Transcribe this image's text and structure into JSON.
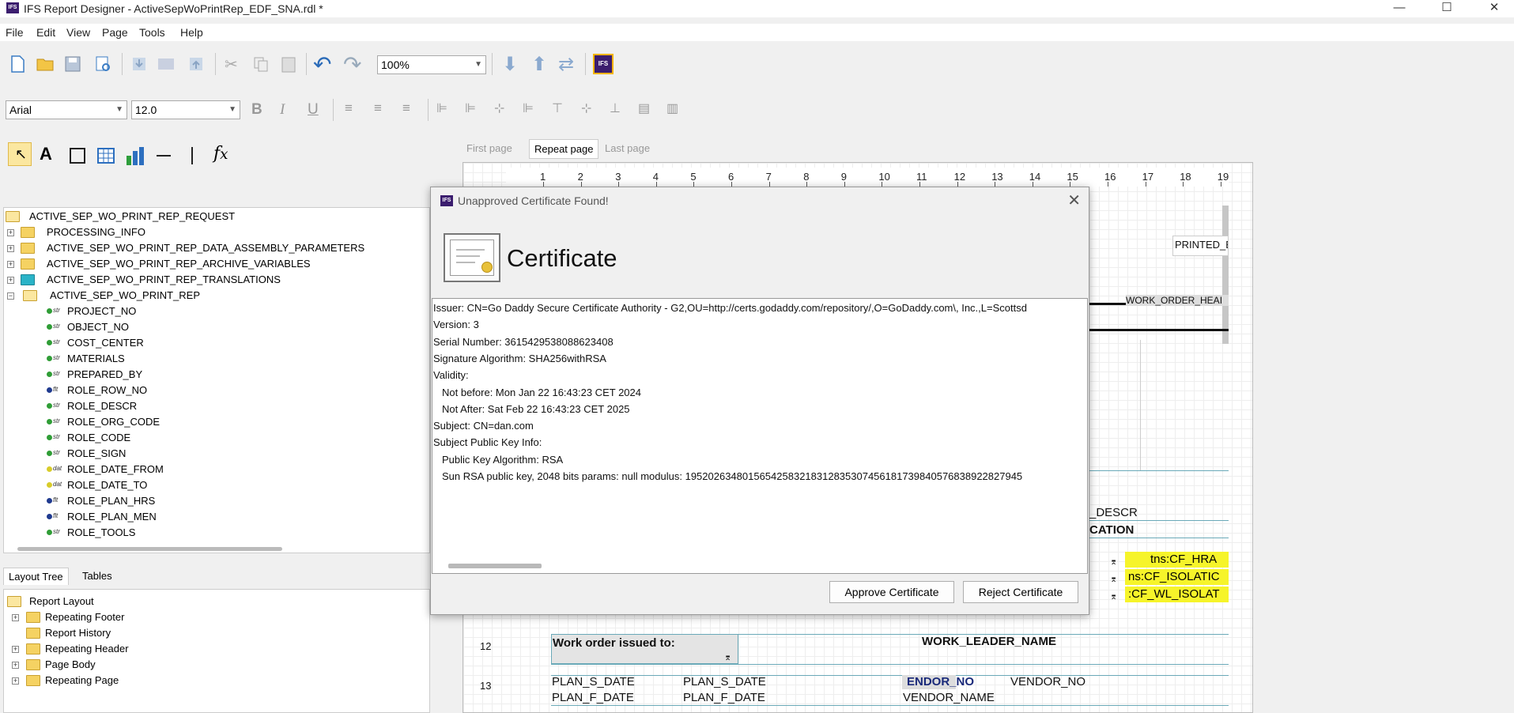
{
  "window": {
    "title": "IFS Report Designer - ActiveSepWoPrintRep_EDF_SNA.rdl *",
    "app_icon": "IFS",
    "controls": [
      "—",
      "☐",
      "✕"
    ]
  },
  "menu": [
    "File",
    "Edit",
    "View",
    "Page",
    "Tools",
    "Help"
  ],
  "toolbar": {
    "zoom": "100%",
    "font": "Arial",
    "font_size": "12.0"
  },
  "page_tabs": [
    "First page",
    "Repeat page",
    "Last page"
  ],
  "ruler": [
    "1",
    "2",
    "3",
    "4",
    "5",
    "6",
    "7",
    "8",
    "9",
    "10",
    "11",
    "12",
    "13",
    "14",
    "15",
    "16",
    "17",
    "18",
    "19"
  ],
  "tree": {
    "root": "ACTIVE_SEP_WO_PRINT_REP_REQUEST",
    "folders": [
      "PROCESSING_INFO",
      "ACTIVE_SEP_WO_PRINT_REP_DATA_ASSEMBLY_PARAMETERS",
      "ACTIVE_SEP_WO_PRINT_REP_ARCHIVE_VARIABLES",
      "ACTIVE_SEP_WO_PRINT_REP_TRANSLATIONS",
      "ACTIVE_SEP_WO_PRINT_REP"
    ],
    "leaves": [
      {
        "type": "str",
        "name": "PROJECT_NO"
      },
      {
        "type": "str",
        "name": "OBJECT_NO"
      },
      {
        "type": "str",
        "name": "COST_CENTER"
      },
      {
        "type": "str",
        "name": "MATERIALS"
      },
      {
        "type": "str",
        "name": "PREPARED_BY"
      },
      {
        "type": "flt",
        "name": "ROLE_ROW_NO"
      },
      {
        "type": "str",
        "name": "ROLE_DESCR"
      },
      {
        "type": "str",
        "name": "ROLE_ORG_CODE"
      },
      {
        "type": "str",
        "name": "ROLE_CODE"
      },
      {
        "type": "str",
        "name": "ROLE_SIGN"
      },
      {
        "type": "dat",
        "name": "ROLE_DATE_FROM"
      },
      {
        "type": "dat",
        "name": "ROLE_DATE_TO"
      },
      {
        "type": "flt",
        "name": "ROLE_PLAN_HRS"
      },
      {
        "type": "flt",
        "name": "ROLE_PLAN_MEN"
      },
      {
        "type": "str",
        "name": "ROLE_TOOLS"
      }
    ]
  },
  "bottom_tabs": [
    "Layout Tree",
    "Tables"
  ],
  "layout_tree": {
    "root": "Report Layout",
    "items": [
      "Repeating Footer",
      "Report History",
      "Repeating Header",
      "Page Body",
      "Repeating Page"
    ]
  },
  "canvas": {
    "printed": "PRINTED_E",
    "wo_header": "WORK_ORDER_HEAI",
    "descr": "_DESCR",
    "cation": "CATION",
    "yellow": [
      "tns:CF_HRA",
      "ns:CF_ISOLATIC",
      ":CF_WL_ISOLAT"
    ],
    "row12": "12",
    "row13": "13",
    "issued_to": "Work order issued to:",
    "work_leader": "WORK_LEADER_NAME",
    "plan_s_1": "PLAN_S_DATE",
    "plan_s_2": "PLAN_S_DATE",
    "plan_f_1": "PLAN_F_DATE",
    "plan_f_2": "PLAN_F_DATE",
    "vendor_no_bold": "ENDOR_NO",
    "vendor_no": "VENDOR_NO",
    "vendor_name": "VENDOR_NAME"
  },
  "dialog": {
    "title": "Unapproved Certificate Found!",
    "heading": "Certificate",
    "lines": [
      "Issuer: CN=Go Daddy Secure Certificate Authority - G2,OU=http://certs.godaddy.com/repository/,O=GoDaddy.com\\, Inc.,L=Scottsd",
      "Version: 3",
      "Serial Number: 3615429538088623408",
      "Signature Algorithm: SHA256withRSA",
      "Validity:",
      "  Not before: Mon Jan 22 16:43:23 CET 2024",
      "  Not After: Sat Feb 22 16:43:23 CET 2025",
      "Subject: CN=dan.com",
      "Subject Public Key Info:",
      "  Public Key Algorithm: RSA",
      "  Sun RSA public key, 2048 bits  params: null  modulus: 19520263480156542583218312835307456181739840576838922827945"
    ],
    "approve": "Approve Certificate",
    "reject": "Reject Certificate"
  }
}
